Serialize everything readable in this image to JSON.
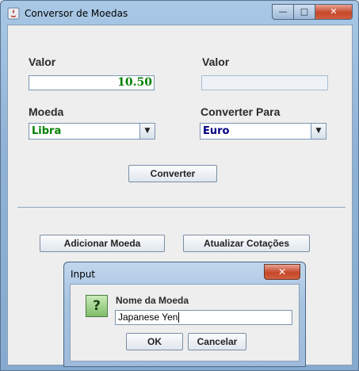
{
  "window": {
    "title": "Conversor de Moedas",
    "controls": {
      "minimize": "—",
      "maximize": "□",
      "close": "✕"
    }
  },
  "form": {
    "valor_label": "Valor",
    "valor_value": "10.50",
    "result_label": "Valor",
    "result_value": "",
    "moeda_label": "Moeda",
    "moeda_selected": "Libra",
    "converter_para_label": "Converter Para",
    "converter_para_selected": "Euro",
    "converter_button": "Converter",
    "adicionar_button": "Adicionar Moeda",
    "atualizar_button": "Atualizar Cotações"
  },
  "dialog": {
    "title": "Input",
    "icon_glyph": "?",
    "label": "Nome da Moeda",
    "input_value": "Japanese Yen",
    "ok_button": "OK",
    "cancel_button": "Cancelar"
  },
  "colors": {
    "valor_text": "#008000",
    "moeda_text": "#008000",
    "converter_para_text": "#000080"
  }
}
